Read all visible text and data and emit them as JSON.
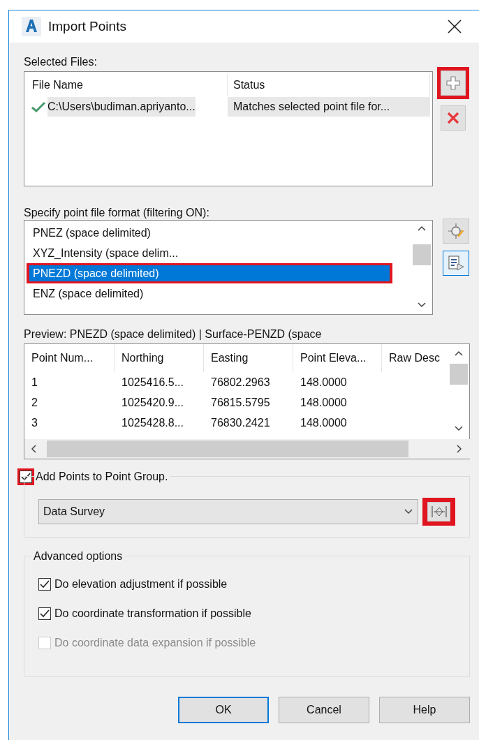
{
  "window": {
    "title": "Import Points"
  },
  "selected_files": {
    "label": "Selected Files:",
    "columns": [
      "File Name",
      "Status"
    ],
    "rows": [
      {
        "file_name": "C:\\Users\\budiman.apriyanto...",
        "status": "Matches selected point file for...",
        "valid": true
      }
    ]
  },
  "file_buttons": [
    {
      "kind": "add",
      "highlighted": true
    },
    {
      "kind": "remove",
      "highlighted": false
    }
  ],
  "format": {
    "label": "Specify point file format (filtering ON):",
    "items": [
      {
        "label": "PNEZ (space delimited)",
        "selected": false,
        "highlighted": false
      },
      {
        "label": "XYZ_Intensity (space delim...",
        "selected": false,
        "highlighted": false
      },
      {
        "label": "PNEZD (space delimited)",
        "selected": true,
        "highlighted": true
      },
      {
        "label": "ENZ (space delimited)",
        "selected": false,
        "highlighted": false
      }
    ]
  },
  "format_buttons": [
    {
      "kind": "edit",
      "selected": false
    },
    {
      "kind": "manage",
      "selected": true
    }
  ],
  "preview": {
    "label": "Preview: PNEZD (space delimited) | Surface-PENZD (space",
    "columns": [
      "Point Num...",
      "Northing",
      "Easting",
      "Point Eleva...",
      "Raw Desc"
    ],
    "rows": [
      [
        "1",
        "1025416.5...",
        "76802.2963",
        "148.0000"
      ],
      [
        "2",
        "1025420.9...",
        "76815.5795",
        "148.0000"
      ],
      [
        "3",
        "1025428.8...",
        "76830.2421",
        "148.0000"
      ]
    ]
  },
  "point_group": {
    "label": "Add Points to Point Group.",
    "checked": true,
    "highlighted": true,
    "value": "Data Survey",
    "button_highlighted": true
  },
  "advanced": {
    "title": "Advanced options",
    "options": [
      {
        "label": "Do elevation adjustment if possible",
        "checked": true,
        "disabled": false
      },
      {
        "label": "Do coordinate transformation if possible",
        "checked": true,
        "disabled": false
      },
      {
        "label": "Do coordinate data expansion if possible",
        "checked": false,
        "disabled": true
      }
    ]
  },
  "buttons": [
    {
      "label": "OK",
      "default": true
    },
    {
      "label": "Cancel",
      "default": false
    },
    {
      "label": "Help",
      "default": false
    }
  ]
}
